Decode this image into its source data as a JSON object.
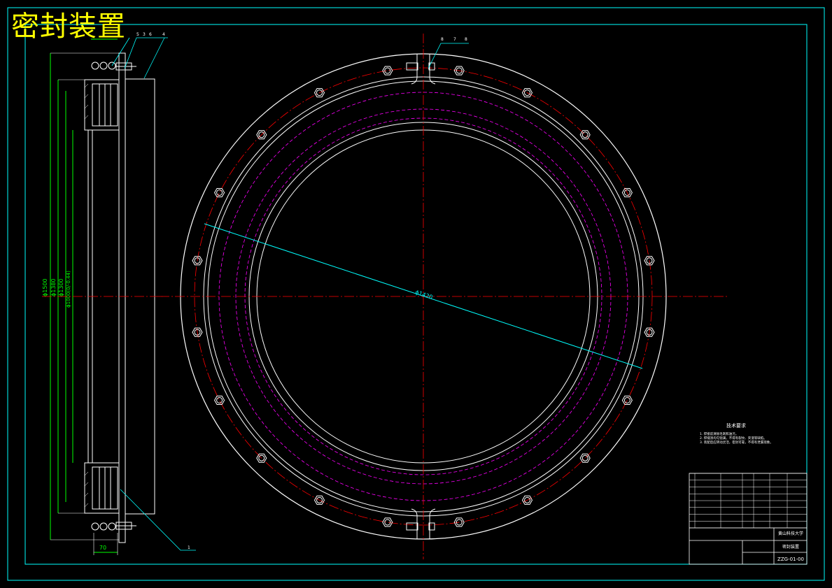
{
  "drawing": {
    "title": "密封装置",
    "dimensions": {
      "d1500": "ϕ1500",
      "d1380": "ϕ1380",
      "d1300": "ϕ1300",
      "d1000": "ϕ1000(0/-0.44)",
      "width70": "70",
      "bolt_circle": "ϕ1420"
    },
    "balloons_left": [
      "5",
      "3",
      "6",
      "4"
    ],
    "balloons_right": [
      "8",
      "7",
      "8"
    ],
    "balloon_bottom": "1",
    "tech_requirements": {
      "heading": "技术要求",
      "lines": [
        "1. 焊接前清除毛刺和油污。",
        "2. 焊缝须均匀饱满，不得有裂纹、夹渣等缺陷。",
        "3. 装配后应转动灵活，密封可靠，不得有泄漏现象。"
      ]
    },
    "title_block": {
      "school": "黄山科技大学",
      "drawing_name": "密封装置",
      "drawing_number": "ZZG-01-00"
    },
    "colors": {
      "background": "#000000",
      "outline": "#ffffff",
      "centerline": "#ff0000",
      "dashed": "#ff00ff",
      "dimension": "#00ff00",
      "leader": "#00ffff",
      "border": "#00ffff",
      "title": "#ffff00"
    }
  }
}
